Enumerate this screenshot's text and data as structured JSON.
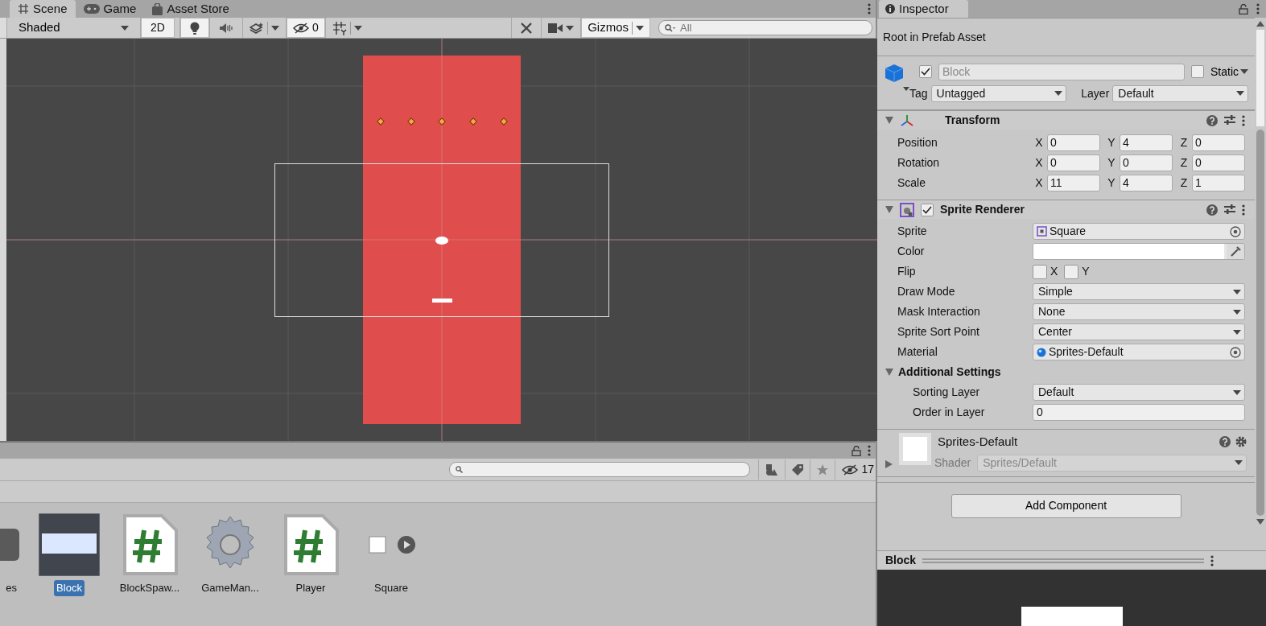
{
  "scene_tabs": [
    {
      "label": "Scene",
      "selected": true
    },
    {
      "label": "Game",
      "selected": false
    },
    {
      "label": "Asset Store",
      "selected": false
    }
  ],
  "scene_toolbar": {
    "shading_mode": "Shaded",
    "mode_2d": {
      "label": "2D",
      "on": true
    },
    "lighting_on": true,
    "audio_on": false,
    "effects_on": false,
    "hidden_count": "0",
    "grid_visible": false,
    "gizmos": "Gizmos",
    "search": {
      "placeholder": "All"
    }
  },
  "project": {
    "hidden_count": "17",
    "assets": [
      {
        "label": "es",
        "kind": "folder",
        "selected": false
      },
      {
        "label": "Block",
        "kind": "prefab",
        "selected": true
      },
      {
        "label": "BlockSpaw...",
        "kind": "script",
        "selected": false
      },
      {
        "label": "GameMan...",
        "kind": "gear",
        "selected": false
      },
      {
        "label": "Player",
        "kind": "script",
        "selected": false
      },
      {
        "label": "Square",
        "kind": "sprite",
        "selected": false
      }
    ]
  },
  "inspector": {
    "tab": "Inspector",
    "header": "Root in Prefab Asset",
    "object": {
      "active": true,
      "name": "Block",
      "static": false,
      "static_label": "Static",
      "tag_label": "Tag",
      "tag": "Untagged",
      "layer_label": "Layer",
      "layer": "Default"
    },
    "transform": {
      "title": "Transform",
      "expanded": true,
      "rows": [
        {
          "label": "Position",
          "fields": [
            {
              "axis": "X",
              "value": "0"
            },
            {
              "axis": "Y",
              "value": "4"
            },
            {
              "axis": "Z",
              "value": "0"
            }
          ]
        },
        {
          "label": "Rotation",
          "fields": [
            {
              "axis": "X",
              "value": "0"
            },
            {
              "axis": "Y",
              "value": "0"
            },
            {
              "axis": "Z",
              "value": "0"
            }
          ]
        },
        {
          "label": "Scale",
          "fields": [
            {
              "axis": "X",
              "value": "11"
            },
            {
              "axis": "Y",
              "value": "4"
            },
            {
              "axis": "Z",
              "value": "1"
            }
          ]
        }
      ]
    },
    "sprite_renderer": {
      "title": "Sprite Renderer",
      "enabled": true,
      "expanded": true,
      "properties": [
        {
          "label": "Sprite",
          "kind": "sprite-ref",
          "value": "Square"
        },
        {
          "label": "Color",
          "kind": "color",
          "color": "#ffffff"
        },
        {
          "label": "Flip",
          "kind": "flip",
          "options": [
            {
              "label": "X",
              "checked": false
            },
            {
              "label": "Y",
              "checked": false
            }
          ]
        },
        {
          "label": "Draw Mode",
          "kind": "dropdown",
          "value": "Simple"
        },
        {
          "label": "Mask Interaction",
          "kind": "dropdown",
          "value": "None"
        },
        {
          "label": "Sprite Sort Point",
          "kind": "dropdown",
          "value": "Center"
        },
        {
          "label": "Material",
          "kind": "material-ref",
          "value": "Sprites-Default"
        }
      ],
      "additional": {
        "title": "Additional Settings",
        "expanded": true,
        "properties": [
          {
            "label": "Sorting Layer",
            "kind": "dropdown",
            "value": "Default"
          },
          {
            "label": "Order in Layer",
            "kind": "number",
            "value": "0"
          }
        ]
      }
    },
    "material": {
      "name": "Sprites-Default",
      "shader_label": "Shader",
      "shader": "Sprites/Default",
      "expanded": false
    },
    "add_component": "Add Component",
    "preview": {
      "title": "Block"
    }
  }
}
